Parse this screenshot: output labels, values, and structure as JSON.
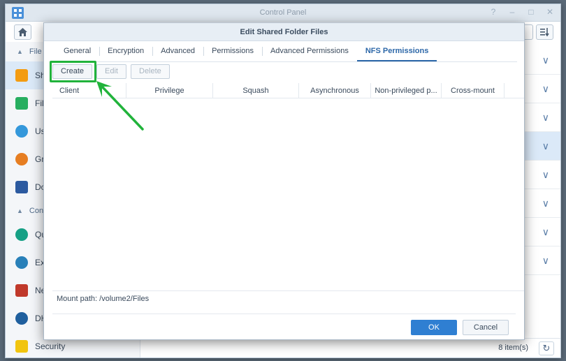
{
  "window": {
    "title": "Control Panel",
    "controls": [
      "?",
      "–",
      "□",
      "✕"
    ]
  },
  "sidebar": {
    "groups": [
      {
        "label": "File"
      },
      {
        "label": "Con"
      }
    ],
    "items": [
      {
        "label": "Sh",
        "icon": "shared-folder-icon",
        "color": "#f39c12"
      },
      {
        "label": "Fil",
        "icon": "file-services-icon",
        "color": "#27ae60"
      },
      {
        "label": "Us",
        "icon": "user-icon",
        "color": "#3498db"
      },
      {
        "label": "Gr",
        "icon": "group-icon",
        "color": "#e67e22"
      },
      {
        "label": "Do",
        "icon": "domain-icon",
        "color": "#2c5aa0"
      },
      {
        "label": "Qu",
        "icon": "quickconnect-icon",
        "color": "#16a085"
      },
      {
        "label": "Ex",
        "icon": "external-access-icon",
        "color": "#2980b9"
      },
      {
        "label": "Ne",
        "icon": "network-icon",
        "color": "#c0392b"
      },
      {
        "label": "DH",
        "icon": "dhcp-icon",
        "color": "#1f5f9e"
      },
      {
        "label": "Security",
        "icon": "security-shield-icon",
        "color": "#f1c40f"
      }
    ]
  },
  "list": {
    "count_label": "8 item(s)"
  },
  "dialog": {
    "title": "Edit Shared Folder Files",
    "tabs": [
      "General",
      "Encryption",
      "Advanced",
      "Permissions",
      "Advanced Permissions",
      "NFS Permissions"
    ],
    "active_tab": "NFS Permissions",
    "buttons": {
      "create": "Create",
      "edit": "Edit",
      "delete": "Delete"
    },
    "columns": [
      "Client",
      "Privilege",
      "Squash",
      "Asynchronous",
      "Non-privileged p...",
      "Cross-mount"
    ],
    "mount_path_label": "Mount path:",
    "mount_path_value": "/volume2/Files",
    "ok": "OK",
    "cancel": "Cancel"
  },
  "annotation": {
    "highlight_color": "#21b33b"
  }
}
